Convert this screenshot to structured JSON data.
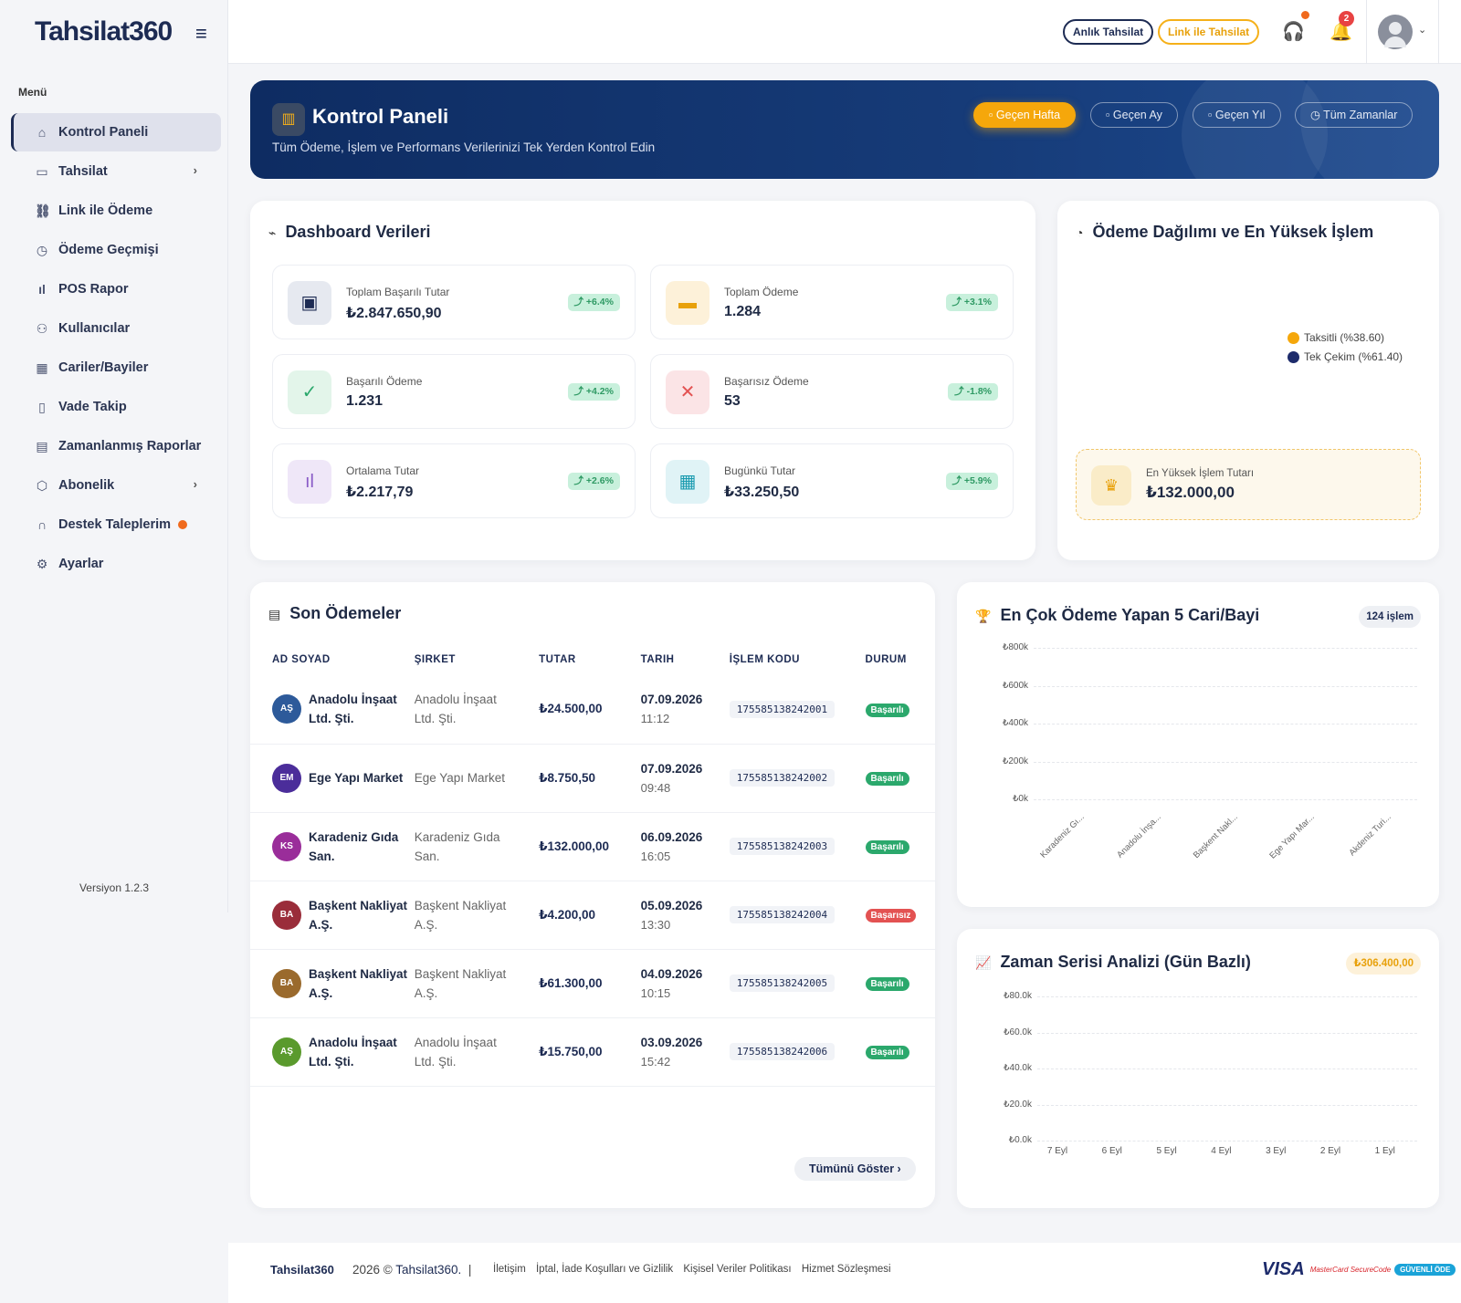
{
  "app": {
    "logo_text": "Tahsilat360",
    "menu_label": "Menü",
    "version": "Versiyon 1.2.3"
  },
  "sidebar": {
    "items": [
      {
        "label": "Kontrol Paneli",
        "icon": "home-icon",
        "active": true
      },
      {
        "label": "Tahsilat",
        "icon": "card-icon",
        "expand": true
      },
      {
        "label": "Link ile Ödeme",
        "icon": "link-icon"
      },
      {
        "label": "Ödeme Geçmişi",
        "icon": "clock-icon"
      },
      {
        "label": "POS Rapor",
        "icon": "bar-chart-icon"
      },
      {
        "label": "Kullanıcılar",
        "icon": "users-icon"
      },
      {
        "label": "Cariler/Bayiler",
        "icon": "building-icon"
      },
      {
        "label": "Vade Takip",
        "icon": "file-icon"
      },
      {
        "label": "Zamanlanmış Raporlar",
        "icon": "report-icon"
      },
      {
        "label": "Abonelik",
        "icon": "package-icon",
        "expand": true
      },
      {
        "label": "Destek Taleplerim",
        "icon": "headset-icon",
        "dot": true
      },
      {
        "label": "Ayarlar",
        "icon": "gear-icon"
      }
    ]
  },
  "topbar": {
    "instant_label": "Anlık Tahsilat",
    "link_label": "Link ile Tahsilat",
    "notification_count": "2"
  },
  "hero": {
    "title": "Kontrol Paneli",
    "subtitle": "Tüm Ödeme, İşlem ve Performans Verilerinizi Tek Yerden Kontrol Edin",
    "filters": [
      {
        "label": "Geçen Hafta",
        "active": true
      },
      {
        "label": "Geçen Ay"
      },
      {
        "label": "Geçen Yıl"
      },
      {
        "label": "Tüm Zamanlar"
      }
    ]
  },
  "dashboard": {
    "title": "Dashboard Verileri",
    "stats": [
      {
        "label": "Toplam Başarılı Tutar",
        "value": "₺2.847.650,90",
        "trend": "+6.4%",
        "icon": "wallet-icon",
        "bg": "#e6e9f0",
        "fg": "#1d2b53"
      },
      {
        "label": "Toplam Ödeme",
        "value": "1.284",
        "trend": "+3.1%",
        "icon": "credit-card-icon",
        "bg": "#fdf1d9",
        "fg": "#e8a10b"
      },
      {
        "label": "Başarılı Ödeme",
        "value": "1.231",
        "trend": "+4.2%",
        "icon": "check-circle-icon",
        "bg": "#e3f5ea",
        "fg": "#2ba86c"
      },
      {
        "label": "Başarısız Ödeme",
        "value": "53",
        "trend": "-1.8%",
        "icon": "x-circle-icon",
        "bg": "#fbe4e6",
        "fg": "#e35252"
      },
      {
        "label": "Ortalama Tutar",
        "value": "₺2.217,79",
        "trend": "+2.6%",
        "icon": "chart-icon",
        "bg": "#efe7f8",
        "fg": "#8a5cc7"
      },
      {
        "label": "Bugünkü Tutar",
        "value": "₺33.250,50",
        "trend": "+5.9%",
        "icon": "calendar-check-icon",
        "bg": "#e0f3f6",
        "fg": "#1a9bb0"
      }
    ]
  },
  "distribution": {
    "title": "Ödeme Dağılımı ve En Yüksek İşlem",
    "legend": [
      {
        "label": "Taksitli (%38.60)",
        "color": "#f5a70b"
      },
      {
        "label": "Tek Çekim (%61.40)",
        "color": "#1d2b6b"
      }
    ],
    "peak_label": "En Yüksek İşlem Tutarı",
    "peak_value": "₺132.000,00"
  },
  "payments": {
    "title": "Son Ödemeler",
    "columns": [
      "AD SOYAD",
      "ŞIRKET",
      "TUTAR",
      "TARIH",
      "İŞLEM KODU",
      "DURUM"
    ],
    "rows": [
      {
        "initials": "AŞ",
        "color": "#2d5a9a",
        "name": "Anadolu İnşaat Ltd. Şti.",
        "company": "Anadolu İnşaat Ltd. Şti.",
        "amount": "₺24.500,00",
        "date": "07.09.2026",
        "time": "11:12",
        "code": "175585138242001",
        "status": "Başarılı",
        "ok": true
      },
      {
        "initials": "EM",
        "color": "#4b2d9a",
        "name": "Ege Yapı Market",
        "company": "Ege Yapı Market",
        "amount": "₺8.750,50",
        "date": "07.09.2026",
        "time": "09:48",
        "code": "175585138242002",
        "status": "Başarılı",
        "ok": true
      },
      {
        "initials": "KS",
        "color": "#9a2d9a",
        "name": "Karadeniz Gıda San.",
        "company": "Karadeniz Gıda San.",
        "amount": "₺132.000,00",
        "date": "06.09.2026",
        "time": "16:05",
        "code": "175585138242003",
        "status": "Başarılı",
        "ok": true
      },
      {
        "initials": "BA",
        "color": "#9a2d3a",
        "name": "Başkent Nakliyat A.Ş.",
        "company": "Başkent Nakliyat A.Ş.",
        "amount": "₺4.200,00",
        "date": "05.09.2026",
        "time": "13:30",
        "code": "175585138242004",
        "status": "Başarısız",
        "ok": false
      },
      {
        "initials": "BA",
        "color": "#9a6a2d",
        "name": "Başkent Nakliyat A.Ş.",
        "company": "Başkent Nakliyat A.Ş.",
        "amount": "₺61.300,00",
        "date": "04.09.2026",
        "time": "10:15",
        "code": "175585138242005",
        "status": "Başarılı",
        "ok": true
      },
      {
        "initials": "AŞ",
        "color": "#5a9a2d",
        "name": "Anadolu İnşaat Ltd. Şti.",
        "company": "Anadolu İnşaat Ltd. Şti.",
        "amount": "₺15.750,00",
        "date": "03.09.2026",
        "time": "15:42",
        "code": "175585138242006",
        "status": "Başarılı",
        "ok": true
      }
    ],
    "show_all": "Tümünü Göster"
  },
  "top5": {
    "title": "En Çok Ödeme Yapan 5 Cari/Bayi",
    "badge": "124 işlem",
    "y_ticks": [
      "₺800k",
      "₺600k",
      "₺400k",
      "₺200k",
      "₺0k"
    ],
    "categories": [
      "Karadeniz Gı...",
      "Anadolu İnşa...",
      "Başkent Nakl...",
      "Ege Yapı Mar...",
      "Akdeniz Turi..."
    ]
  },
  "timeseries": {
    "title": "Zaman Serisi Analizi (Gün Bazlı)",
    "badge": "₺306.400,00",
    "y_ticks": [
      "₺80.0k",
      "₺60.0k",
      "₺40.0k",
      "₺20.0k",
      "₺0.0k"
    ],
    "x_labels": [
      "7 Eyl",
      "6 Eyl",
      "5 Eyl",
      "4 Eyl",
      "3 Eyl",
      "2 Eyl",
      "1 Eyl"
    ]
  },
  "footer": {
    "logo_text": "Tahsilat360",
    "copyright": "2026 ©",
    "brand": "Tahsilat360.",
    "separator": "|",
    "links": [
      "İletişim",
      "İptal, İade Koşulları ve Gizlilik",
      "Kişisel Veriler Politikası",
      "Hizmet Sözleşmesi"
    ],
    "visa": "VISA",
    "mastercard": "MasterCard SecureCode",
    "guvenli": "GÜVENLİ ÖDE"
  }
}
